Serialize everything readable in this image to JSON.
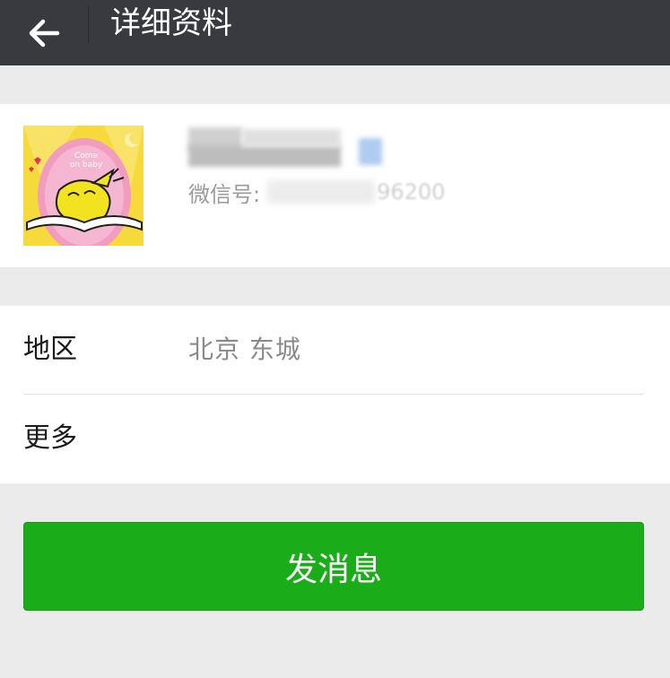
{
  "header": {
    "back_icon": "arrow-left-icon",
    "title": "详细资料"
  },
  "profile": {
    "avatar_icon": "cartoon-chick-avatar",
    "avatar_text_line1": "Come",
    "avatar_text_line2": "on baby",
    "nickname": "",
    "wechat_id_label": "微信号:",
    "wechat_id_value": "96200"
  },
  "details": {
    "region_label": "地区",
    "region_value": "北京  东城",
    "more_label": "更多"
  },
  "actions": {
    "send_message_label": "发消息"
  },
  "colors": {
    "topbar": "#393a3f",
    "background": "#ebebeb",
    "primary_button": "#1aad19"
  }
}
